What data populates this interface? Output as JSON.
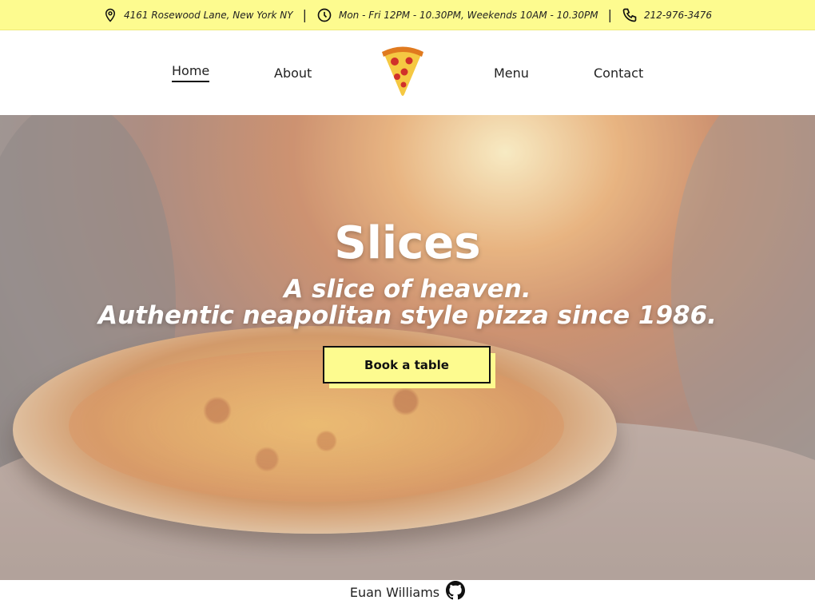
{
  "infobar": {
    "address": "4161 Rosewood Lane, New York NY",
    "hours": "Mon - Fri 12PM - 10.30PM, Weekends 10AM - 10.30PM",
    "phone": "212-976-3476",
    "separator": "|",
    "icons": [
      "map-pin-icon",
      "clock-icon",
      "phone-icon"
    ]
  },
  "nav": {
    "items": [
      {
        "label": "Home",
        "active": true
      },
      {
        "label": "About"
      },
      {
        "label": "Menu"
      },
      {
        "label": "Contact"
      }
    ],
    "logo_icon": "pizza-slice-icon"
  },
  "hero": {
    "title": "Slices",
    "tagline_line1": "A slice of heaven.",
    "tagline_line2": "Authentic neapolitan style pizza since 1986.",
    "cta_label": "Book a table"
  },
  "footer": {
    "author": "Euan Williams",
    "icon": "github-icon"
  },
  "colors": {
    "accent_yellow": "#fdfb8f",
    "text_dark": "#111111",
    "hero_text": "#ffffff"
  }
}
